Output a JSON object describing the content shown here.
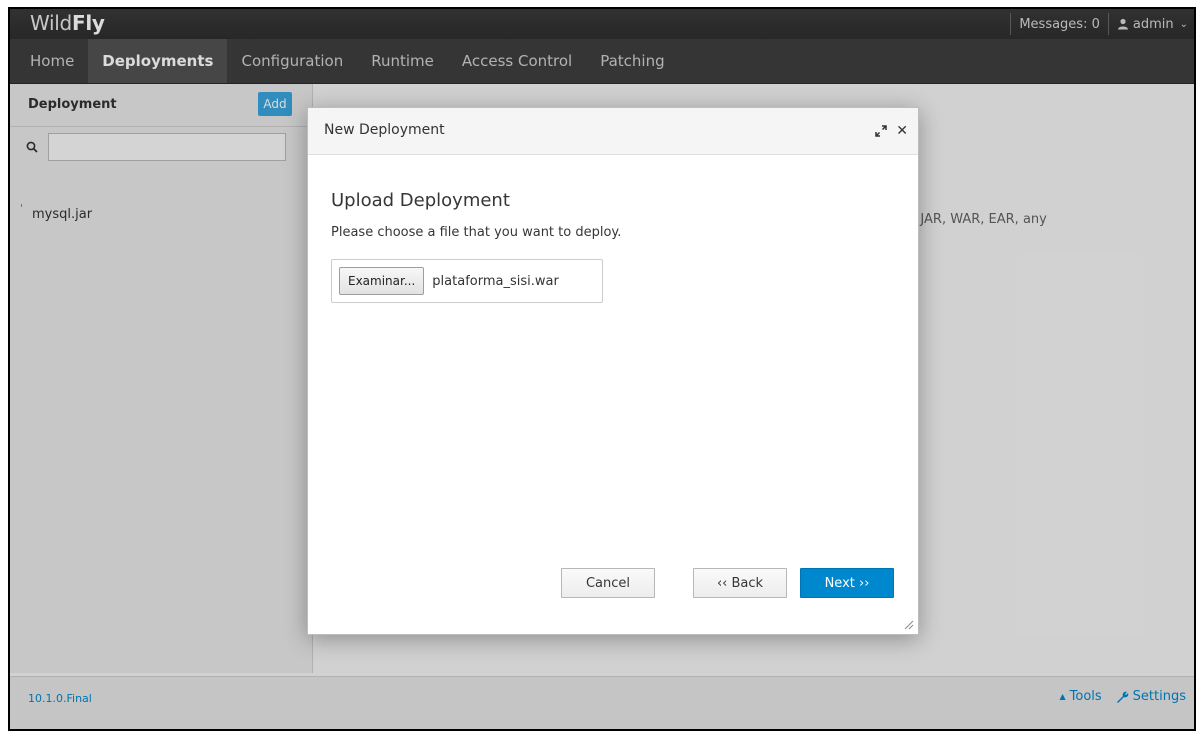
{
  "header": {
    "brand_light": "Wild",
    "brand_bold": "Fly",
    "messages": "Messages: 0",
    "user": "admin"
  },
  "nav": {
    "tabs": [
      {
        "label": "Home",
        "active": false
      },
      {
        "label": "Deployments",
        "active": true
      },
      {
        "label": "Configuration",
        "active": false
      },
      {
        "label": "Runtime",
        "active": false
      },
      {
        "label": "Access Control",
        "active": false
      },
      {
        "label": "Patching",
        "active": false
      }
    ]
  },
  "sidebar": {
    "title": "Deployment",
    "add_label": "Add",
    "search_value": "",
    "items": [
      {
        "label": "mysql.jar"
      }
    ]
  },
  "background": {
    "partial_text": "-JAR, WAR, EAR, any"
  },
  "modal": {
    "title": "New Deployment",
    "heading": "Upload Deployment",
    "description": "Please choose a file that you want to deploy.",
    "browse_label": "Examinar...",
    "selected_file": "plataforma_sisi.war",
    "cancel_label": "Cancel",
    "back_label": "‹‹ Back",
    "next_label": "Next ››"
  },
  "footer": {
    "version": "10.1.0.Final",
    "tools_label": "Tools",
    "settings_label": "Settings"
  },
  "colors": {
    "primary": "#0088ce",
    "add_button": "#39a5dc",
    "header_bg": "#2e2e2e"
  }
}
